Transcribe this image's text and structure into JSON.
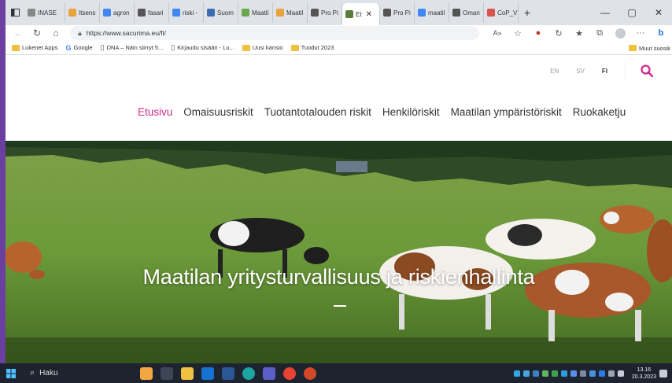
{
  "browser": {
    "tabs": [
      {
        "label": "INASE",
        "color": "#888888"
      },
      {
        "label": "Itsens",
        "color": "#e8a33d"
      },
      {
        "label": "agron",
        "color": "#4285f4"
      },
      {
        "label": "fasari",
        "color": "#555555"
      },
      {
        "label": "riski -",
        "color": "#4285f4"
      },
      {
        "label": "Suom",
        "color": "#3b6db3"
      },
      {
        "label": "Maatil",
        "color": "#6aa84f"
      },
      {
        "label": "Maatil",
        "color": "#e8a33d"
      },
      {
        "label": "Pro Pi",
        "color": "#555555"
      },
      {
        "label": "Et",
        "color": "#5a7d3a",
        "active": true
      },
      {
        "label": "Pro Pi",
        "color": "#555555"
      },
      {
        "label": "maatil",
        "color": "#4285f4"
      },
      {
        "label": "Oman",
        "color": "#555555"
      },
      {
        "label": "CoP_V",
        "color": "#d9534f"
      }
    ],
    "url": "https://www.sacurima.eu/fi/",
    "bookmarks": [
      {
        "label": "Lukenet Apps",
        "icon": "folder-icon"
      },
      {
        "label": "Google",
        "icon": "google-icon"
      },
      {
        "label": "DNA – Näin siirryt 5...",
        "icon": "page-icon"
      },
      {
        "label": "Kirjaudu sisään - Lu...",
        "icon": "page-icon"
      },
      {
        "label": "Uusi kansio",
        "icon": "folder-icon"
      },
      {
        "label": "Tuodut 2023",
        "icon": "folder-icon"
      }
    ],
    "bookmarks_other": "Muut suosik"
  },
  "page": {
    "languages": [
      "EN",
      "SV",
      "FI"
    ],
    "nav": [
      "Etusivu",
      "Omaisuusriskit",
      "Tuotantotalouden riskit",
      "Henkilöriskit",
      "Maatilan ympäristöriskit",
      "Ruokaketju"
    ],
    "hero_title": "Maatilan yritysturvallisuus ja riskienhallinta",
    "accent": "#cc2a8c"
  },
  "taskbar": {
    "search_label": "Haku",
    "time": "13.16",
    "date": "20.3.2023"
  }
}
